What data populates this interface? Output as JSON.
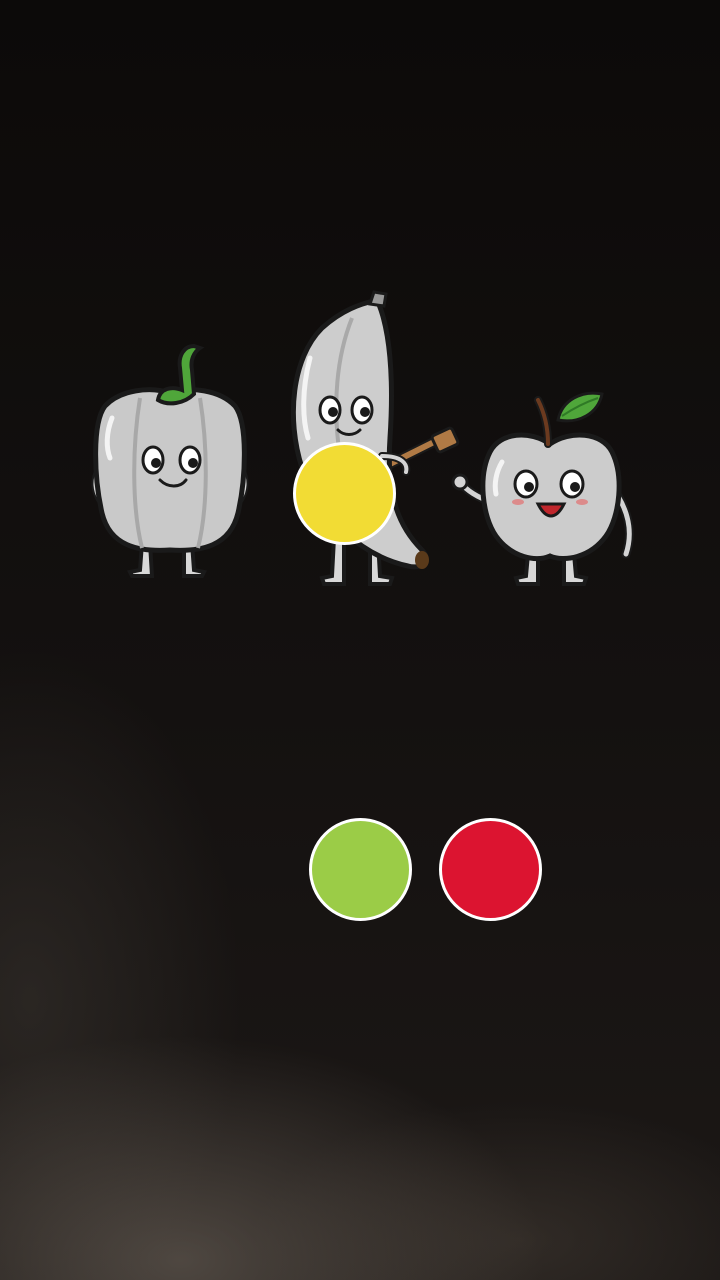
{
  "scene": {
    "characters": [
      {
        "name": "bell-pepper",
        "expected_color": "#9bcc47"
      },
      {
        "name": "banana",
        "expected_color": "#f2dc34"
      },
      {
        "name": "apple",
        "expected_color": "#dc1430"
      }
    ],
    "placed_color": "#f2dc34"
  },
  "palette": {
    "options": [
      {
        "name": "green",
        "hex": "#9bcc47"
      },
      {
        "name": "red",
        "hex": "#dc1430"
      }
    ]
  },
  "theme": {
    "background": "#0f0d0c",
    "character_fill": "#c8c8c8",
    "outline": "#1a1a1a"
  }
}
